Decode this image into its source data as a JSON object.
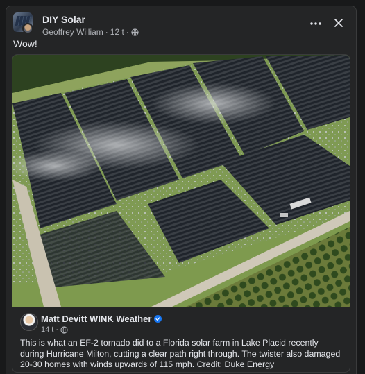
{
  "post": {
    "group_name": "DIY Solar",
    "author": "Geoffrey William",
    "timestamp": "12 t",
    "separator": "·",
    "text": "Wow!"
  },
  "shared_post": {
    "author": "Matt Devitt WINK Weather",
    "timestamp": "14 t",
    "separator": "·",
    "body": "This is what an EF-2 tornado did to a Florida solar farm in Lake Placid recently during Hurricane Milton, cutting a clear path right through. The twister also damaged 20-30 homes with winds upwards of 115 mph. Credit: Duke Energy"
  },
  "icons": {
    "more": "more-horizontal-icon",
    "close": "close-icon",
    "audience": "globe-icon",
    "verified": "verified-badge-icon"
  },
  "colors": {
    "background": "#18191a",
    "card": "#242526",
    "text_primary": "#e4e6eb",
    "text_secondary": "#b0b3b8",
    "verified_blue": "#1877f2"
  }
}
